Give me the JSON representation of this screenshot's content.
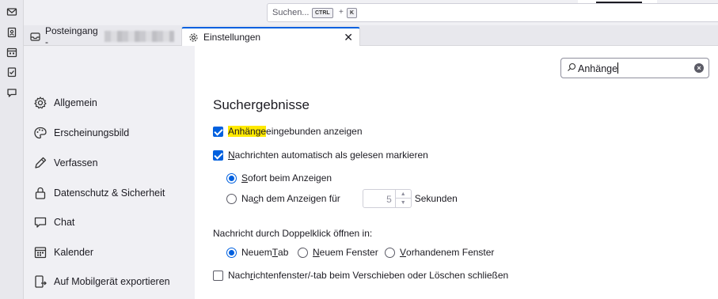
{
  "spaces": [
    "mail-icon",
    "address-book-icon",
    "calendar-icon",
    "tasks-icon",
    "chat-icon"
  ],
  "search": {
    "placeholder": "Suchen...",
    "key1": "CTRL",
    "plus": "+",
    "key2": "K"
  },
  "tabs": [
    {
      "label": "Posteingang -",
      "icon": "inbox-icon",
      "active": false
    },
    {
      "label": "Einstellungen",
      "icon": "gear-icon",
      "active": true,
      "close": "✕"
    }
  ],
  "sidebar": {
    "items": [
      {
        "label": "Allgemein",
        "icon": "gear-icon"
      },
      {
        "label": "Erscheinungsbild",
        "icon": "palette-icon"
      },
      {
        "label": "Verfassen",
        "icon": "pen-icon"
      },
      {
        "label": "Datenschutz & Sicherheit",
        "icon": "lock-icon"
      },
      {
        "label": "Chat",
        "icon": "chat-icon"
      },
      {
        "label": "Kalender",
        "icon": "calendar-icon"
      },
      {
        "label": "Auf Mobilgerät exportieren",
        "icon": "mobile-export-icon"
      }
    ]
  },
  "pref_search": {
    "value": "Anhänge"
  },
  "content": {
    "heading": "Suchergebnisse",
    "opt1": {
      "hl": "Anhänge",
      "rest": " eingebunden anzeigen",
      "checked": true
    },
    "opt2": {
      "u": "N",
      "rest": "achrichten automatisch als gelesen markieren",
      "checked": true
    },
    "radio1": {
      "u": "S",
      "rest": "ofort beim Anzeigen",
      "selected": true
    },
    "radio2": {
      "pre": "Na",
      "u": "c",
      "rest": "h dem Anzeigen für",
      "selected": false
    },
    "spinner": {
      "value": "5",
      "unit": "Sekunden"
    },
    "dblclick_label": "Nachricht durch Doppelklick öffnen in:",
    "open_opts": [
      {
        "pre": "Neuem ",
        "u": "T",
        "rest": "ab",
        "selected": true
      },
      {
        "pre": "",
        "u": "N",
        "rest": "euem Fenster",
        "selected": false
      },
      {
        "pre": "",
        "u": "V",
        "rest": "orhandenem Fenster",
        "selected": false
      }
    ],
    "opt3": {
      "pre": "Nach",
      "u": "r",
      "rest": "ichtenfenster/-tab beim Verschieben oder Löschen schließen",
      "checked": false
    }
  },
  "colors": {
    "accent": "#0060df",
    "highlight": "#ffe900"
  }
}
